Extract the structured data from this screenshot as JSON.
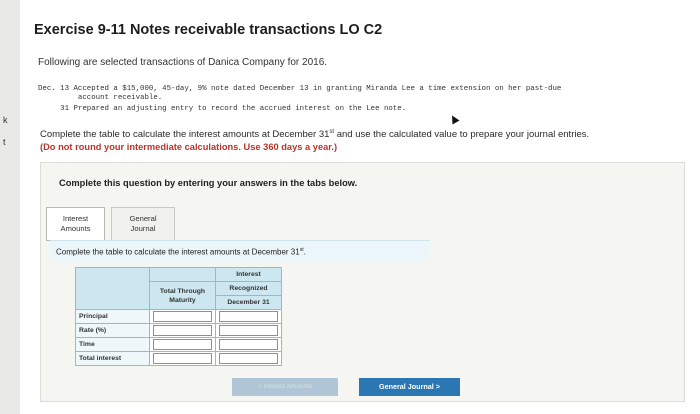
{
  "edge_marks": [
    "k",
    "t"
  ],
  "title": "Exercise 9-11 Notes receivable transactions LO C2",
  "intro": "Following are selected transactions of Danica Company for 2016.",
  "transactions": [
    "Dec. 13 Accepted a $15,000, 45-day, 9% note dated December 13 in granting Miranda Lee a time extension on her past-due",
    "         account receivable.",
    "     31 Prepared an adjusting entry to record the accrued interest on the Lee note."
  ],
  "instructions": {
    "main_before": "Complete the table to calculate the interest amounts at December 31",
    "main_sup": "st",
    "main_after": " and use the calculated value to prepare your journal entries.",
    "warning": "(Do not round your intermediate calculations. Use 360 days a year.)"
  },
  "panel": {
    "heading": "Complete this question by entering your answers in the tabs below.",
    "tabs": [
      {
        "line1": "Interest",
        "line2": "Amounts"
      },
      {
        "line1": "General",
        "line2": "Journal"
      }
    ],
    "sub_instruction_before": "Complete the table to calculate the interest amounts at December 31",
    "sub_instruction_sup": "st",
    "sub_instruction_after": "."
  },
  "table": {
    "headers": {
      "col1": "",
      "col2": "Total Through Maturity",
      "col3_line1": "Interest",
      "col3_line2": "Recognized",
      "col3_line3": "December 31"
    },
    "rows": [
      "Principal",
      "Rate (%)",
      "Time",
      "Total interest"
    ]
  },
  "buttons": {
    "prev": "< Interest Amounts",
    "next": "General Journal >"
  }
}
